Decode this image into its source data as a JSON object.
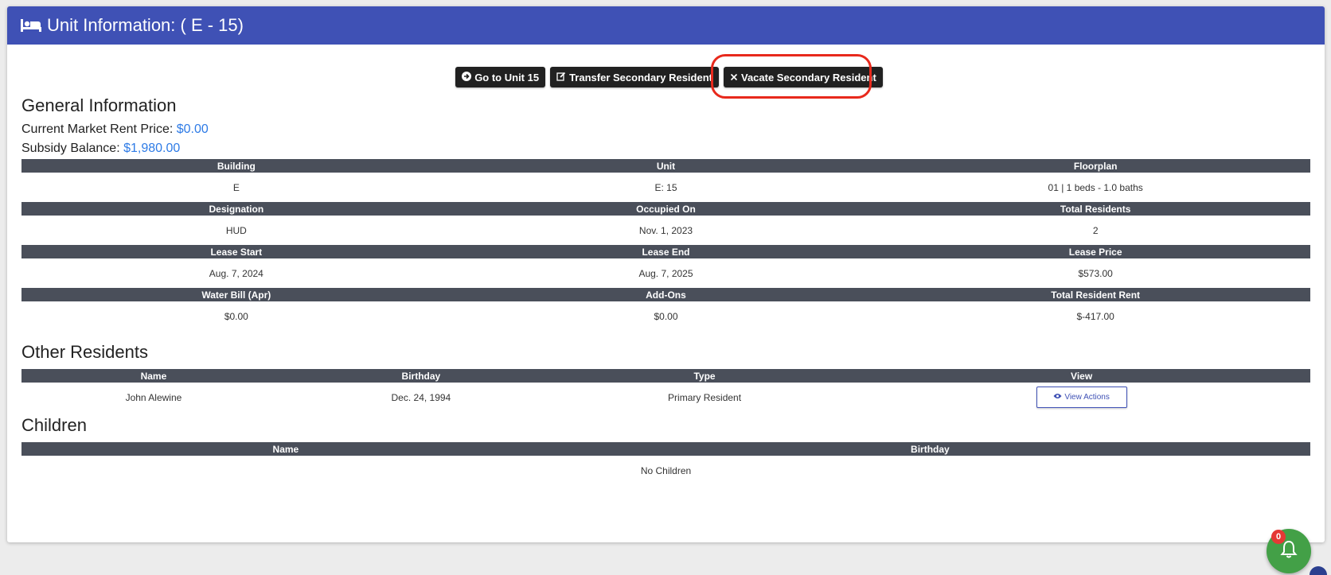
{
  "header": {
    "title": "Unit Information: ( E - 15)"
  },
  "actions": {
    "go_to_unit": "Go to Unit 15",
    "transfer": "Transfer Secondary Resident",
    "vacate": "Vacate Secondary Resident"
  },
  "general": {
    "heading": "General Information",
    "market_rent_label": "Current Market Rent Price:",
    "market_rent_value": "$0.00",
    "subsidy_label": "Subsidy Balance:",
    "subsidy_value": "$1,980.00",
    "rows": [
      {
        "headers": [
          "Building",
          "Unit",
          "Floorplan"
        ],
        "values": [
          "E",
          "E: 15",
          "01 | 1 beds - 1.0 baths"
        ]
      },
      {
        "headers": [
          "Designation",
          "Occupied On",
          "Total Residents"
        ],
        "values": [
          "HUD",
          "Nov. 1, 2023",
          "2"
        ]
      },
      {
        "headers": [
          "Lease Start",
          "Lease End",
          "Lease Price"
        ],
        "values": [
          "Aug. 7, 2024",
          "Aug. 7, 2025",
          "$573.00"
        ]
      },
      {
        "headers": [
          "Water Bill (Apr)",
          "Add-Ons",
          "Total Resident Rent"
        ],
        "values": [
          "$0.00",
          "$0.00",
          "$-417.00"
        ]
      }
    ]
  },
  "other_residents": {
    "heading": "Other Residents",
    "columns": [
      "Name",
      "Birthday",
      "Type",
      "View"
    ],
    "rows": [
      {
        "name": "John Alewine",
        "birthday": "Dec. 24, 1994",
        "type": "Primary Resident",
        "action": "View Actions"
      }
    ]
  },
  "children": {
    "heading": "Children",
    "columns": [
      "Name",
      "Birthday"
    ],
    "empty": "No Children"
  },
  "notifications": {
    "count": "0"
  },
  "colors": {
    "header_bg": "#3f51b5",
    "table_header_bg": "#4a4f5a",
    "money": "#2e7be6",
    "highlight": "#e8291c",
    "fab": "#43a047"
  }
}
